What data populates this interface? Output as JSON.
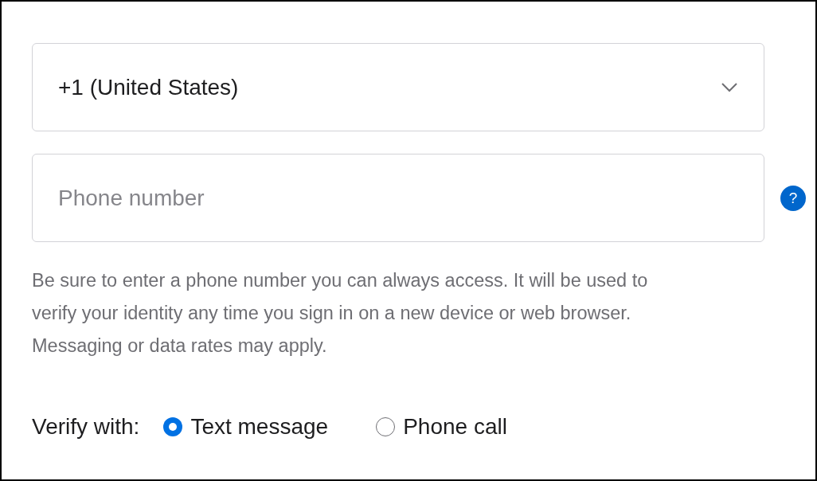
{
  "country_select": {
    "value": "+1 (United States)"
  },
  "phone_field": {
    "placeholder": "Phone number"
  },
  "help_button": {
    "label": "?"
  },
  "description": "Be sure to enter a phone number you can always access. It will be used to verify your identity any time you sign in on a new device or web browser. Messaging or data rates may apply.",
  "verify": {
    "label": "Verify with:",
    "options": [
      {
        "label": "Text message",
        "selected": true
      },
      {
        "label": "Phone call",
        "selected": false
      }
    ]
  }
}
